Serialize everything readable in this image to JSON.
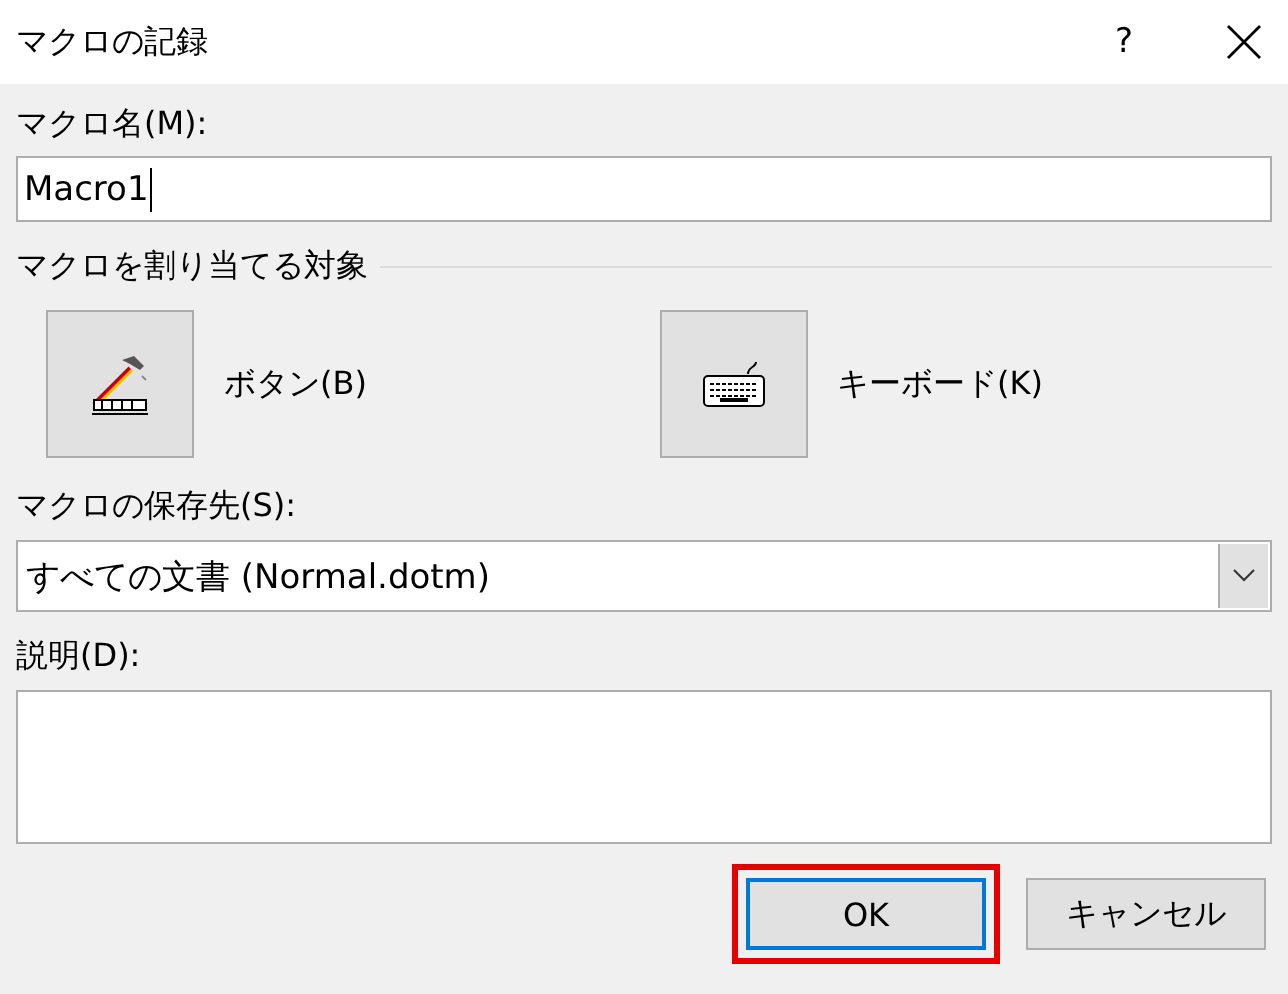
{
  "window": {
    "title": "マクロの記録",
    "help": "?"
  },
  "macro_name": {
    "label": "マクロ名(M):",
    "value": "Macro1"
  },
  "assign": {
    "label": "マクロを割り当てる対象",
    "targets": [
      {
        "kind": "button",
        "label": "ボタン(B)"
      },
      {
        "kind": "keyboard",
        "label": "キーボード(K)"
      }
    ]
  },
  "store_in": {
    "label": "マクロの保存先(S):",
    "value": "すべての文書 (Normal.dotm)"
  },
  "description": {
    "label": "説明(D):"
  },
  "buttons": [
    {
      "label": "OK",
      "default": true,
      "highlighted": true
    },
    {
      "label": "キャンセル",
      "default": false,
      "highlighted": false
    }
  ]
}
